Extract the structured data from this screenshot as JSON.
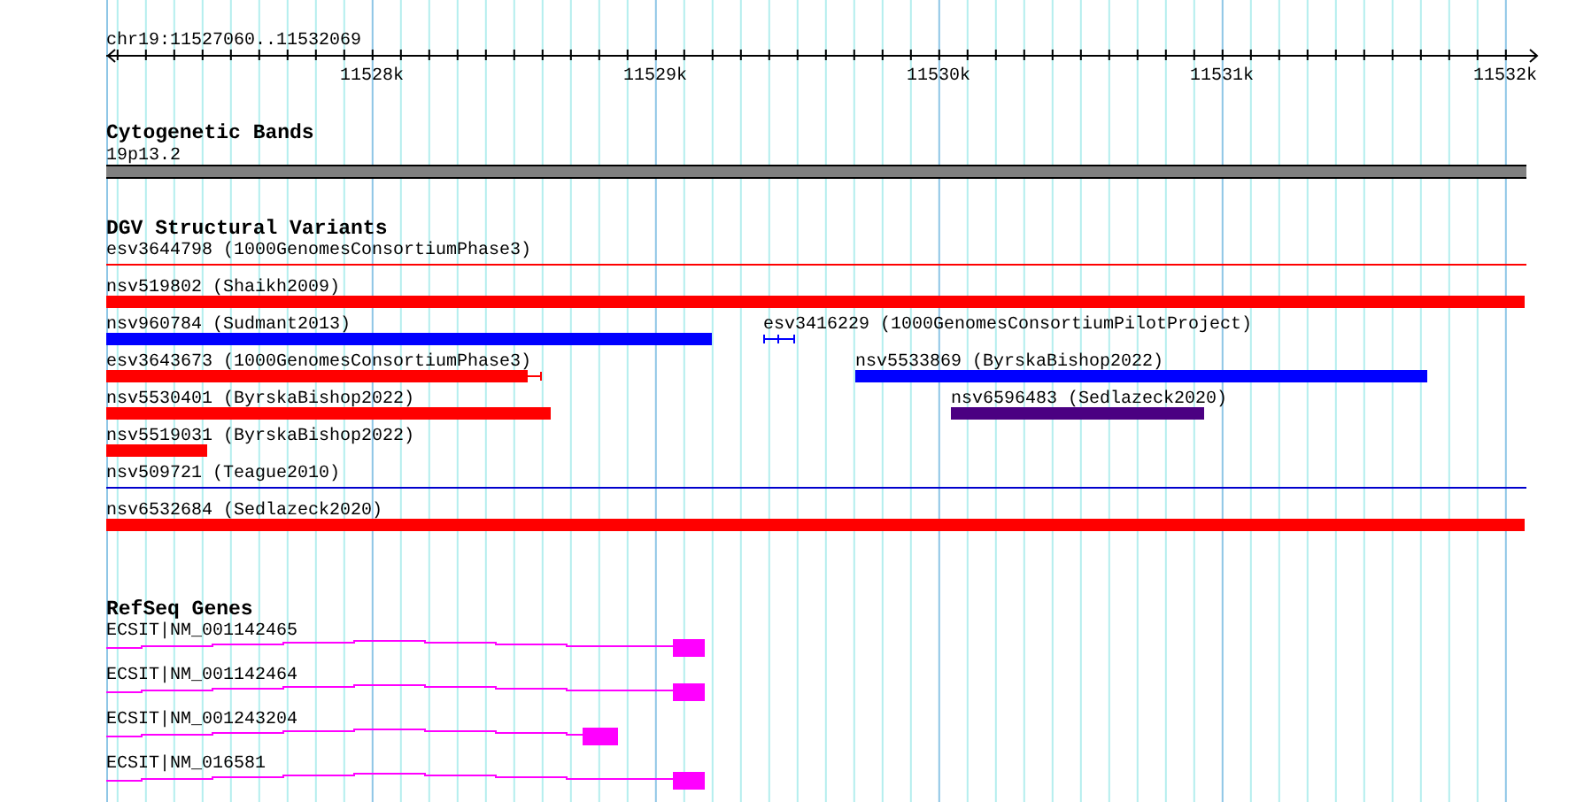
{
  "ruler": {
    "location": "chr19:11527060..11532069",
    "ticks": [
      "11528k",
      "11529k",
      "11530k",
      "11531k",
      "11532k"
    ]
  },
  "tracks": [
    {
      "title": "Cytogenetic Bands",
      "kind": "bands",
      "features": [
        {
          "label": "19p13.2",
          "color": "#808080"
        }
      ]
    },
    {
      "title": "DGV Structural Variants",
      "kind": "variants",
      "features": [
        {
          "label": "esv3644798 (1000GenomesConsortiumPhase3)",
          "color": "#ff0000",
          "kind": "line"
        },
        {
          "label": "nsv519802 (Shaikh2009)",
          "color": "#ff0000",
          "kind": "bar"
        },
        {
          "label": "nsv960784 (Sudmant2013)",
          "color": "#0000ff",
          "kind": "bar"
        },
        {
          "label": "esv3416229 (1000GenomesConsortiumPilotProject)",
          "color": "#0000ff",
          "kind": "segments"
        },
        {
          "label": "esv3643673 (1000GenomesConsortiumPhase3)",
          "color": "#ff0000",
          "kind": "whisker"
        },
        {
          "label": "nsv5533869 (ByrskaBishop2022)",
          "color": "#0000ff",
          "kind": "bar"
        },
        {
          "label": "nsv5530401 (ByrskaBishop2022)",
          "color": "#ff0000",
          "kind": "bar"
        },
        {
          "label": "nsv6596483 (Sedlazeck2020)",
          "color": "#4b0082",
          "kind": "bar"
        },
        {
          "label": "nsv5519031 (ByrskaBishop2022)",
          "color": "#ff0000",
          "kind": "bar"
        },
        {
          "label": "nsv509721 (Teague2010)",
          "color": "#0000cc",
          "kind": "line"
        },
        {
          "label": "nsv6532684 (Sedlazeck2020)",
          "color": "#ff0000",
          "kind": "bar"
        }
      ]
    },
    {
      "title": "RefSeq Genes",
      "kind": "genes",
      "features": [
        {
          "label": "ECSIT|NM_001142465",
          "color": "#ff00ff"
        },
        {
          "label": "ECSIT|NM_001142464",
          "color": "#ff00ff"
        },
        {
          "label": "ECSIT|NM_001243204",
          "color": "#ff00ff"
        },
        {
          "label": "ECSIT|NM_016581",
          "color": "#ff00ff"
        }
      ]
    }
  ]
}
